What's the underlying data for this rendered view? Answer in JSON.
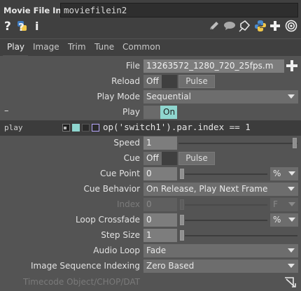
{
  "header": {
    "op_type": "Movie File In",
    "op_name": "moviefilein2"
  },
  "icons": {
    "help": "question-icon",
    "python_help": "python-help-icon",
    "info": "info-icon",
    "edit": "pencil-icon",
    "comment": "comment-icon",
    "docked": "tag-icon",
    "python": "python-logo-icon",
    "add": "plus-icon",
    "target": "target-icon"
  },
  "tabs": [
    "Play",
    "Image",
    "Trim",
    "Tune",
    "Common"
  ],
  "params": {
    "file": {
      "label": "File",
      "value": "13263572_1280_720_25fps.m"
    },
    "reload": {
      "label": "Reload",
      "state": "Off",
      "button": "Pulse"
    },
    "play_mode": {
      "label": "Play Mode",
      "value": "Sequential"
    },
    "play": {
      "label": "Play",
      "state": "On",
      "collapse": "–"
    },
    "play_expr": {
      "label": "play",
      "expression": "op('switch1').par.index == 1"
    },
    "speed": {
      "label": "Speed",
      "value": "1"
    },
    "cue": {
      "label": "Cue",
      "state": "Off",
      "button": "Pulse"
    },
    "cue_point": {
      "label": "Cue Point",
      "value": "0",
      "unit": "%"
    },
    "cue_behavior": {
      "label": "Cue Behavior",
      "value": "On Release, Play Next Frame"
    },
    "index": {
      "label": "Index",
      "value": "0",
      "unit": "F"
    },
    "loop_crossfade": {
      "label": "Loop Crossfade",
      "value": "0",
      "unit": "%"
    },
    "step_size": {
      "label": "Step Size",
      "value": "1"
    },
    "audio_loop": {
      "label": "Audio Loop",
      "value": "Fade"
    },
    "image_seq": {
      "label": "Image Sequence Indexing",
      "value": "Zero Based"
    },
    "timecode": {
      "label": "Timecode Object/CHOP/DAT"
    }
  },
  "colors": {
    "accent": "#8fd6cf",
    "field": "#7d7d7d",
    "background": "#545454",
    "header": "#404040"
  }
}
